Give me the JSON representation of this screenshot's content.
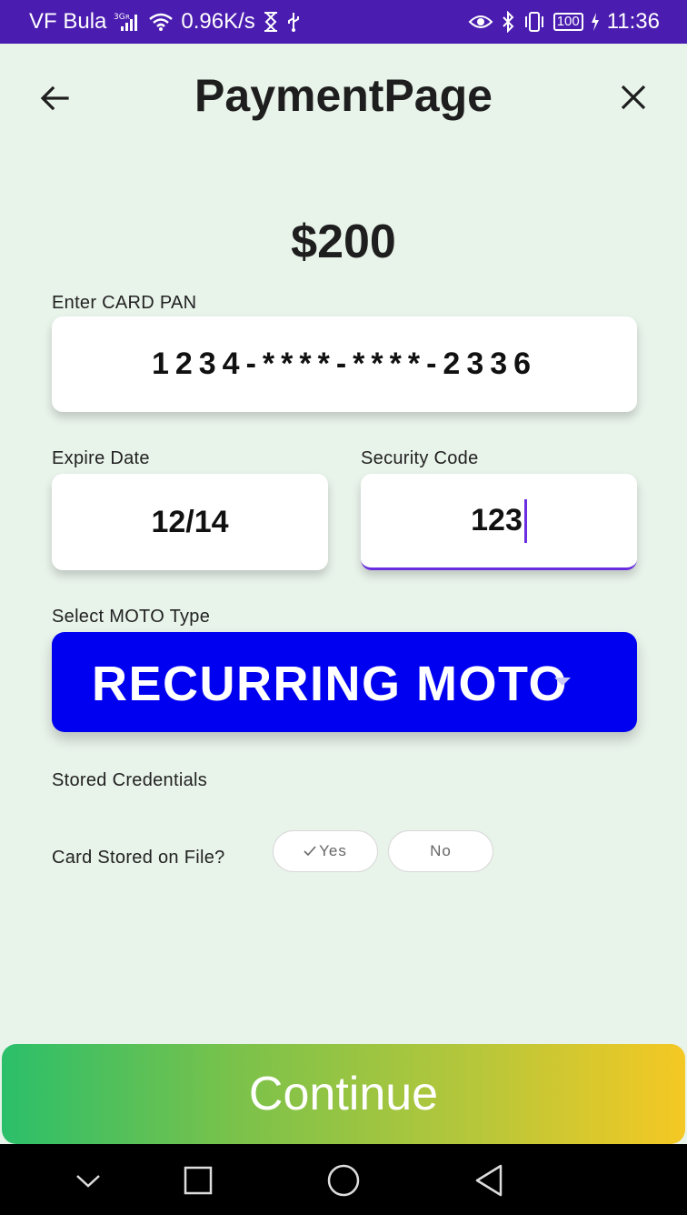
{
  "status_bar": {
    "carrier": "VF Bula",
    "network_type": "3G R",
    "speed": "0.96K/s",
    "battery": "100",
    "time": "11:36"
  },
  "header": {
    "title": "PaymentPage",
    "back_icon": "arrow-left-icon",
    "close_icon": "close-icon"
  },
  "payment": {
    "amount": "$200"
  },
  "card_pan": {
    "label": "Enter CARD PAN",
    "value": "1234-****-****-2336"
  },
  "expire_date": {
    "label": "Expire Date",
    "value": "12/14"
  },
  "security_code": {
    "label": "Security Code",
    "value": "123"
  },
  "moto": {
    "label": "Select MOTO Type",
    "selected": "RECURRING MOTO"
  },
  "stored_credentials": {
    "heading": "Stored Credentials",
    "question": "Card Stored on File?",
    "yes_label": "Yes",
    "no_label": "No",
    "selected": "Yes"
  },
  "actions": {
    "continue_label": "Continue"
  },
  "colors": {
    "status_bar": "#4a1cb0",
    "background": "#e8f3ea",
    "moto_select": "#0000f0",
    "accent": "#6a2ee0",
    "continue_start": "#2bbf6a",
    "continue_end": "#f5c823"
  }
}
